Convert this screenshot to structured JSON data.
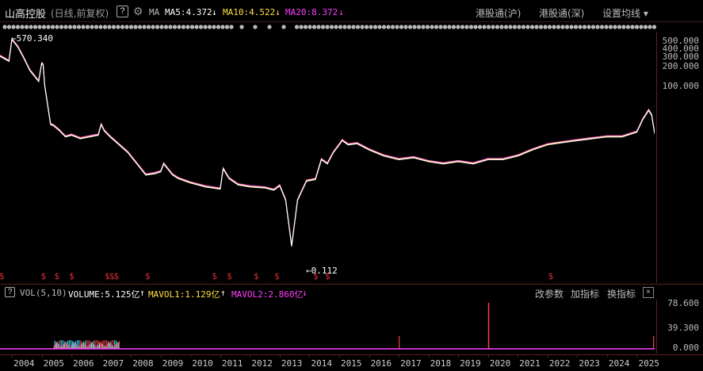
{
  "header": {
    "stock_name": "山高控股",
    "period": "(日线,前复权)",
    "help": "?",
    "ma_label": "MA",
    "ma5": "MA5:4.372",
    "ma5_arrow": "↓",
    "ma10": "MA10:4.522",
    "ma10_arrow": "↓",
    "ma20": "MA20:8.372",
    "ma20_arrow": "↓",
    "tabs": [
      "港股通(沪)",
      "港股通(深)",
      "设置均线 ▾"
    ]
  },
  "price_axis": [
    "500.000",
    "400.000",
    "300.000",
    "200.000",
    "100.000"
  ],
  "annotations": {
    "high": "570.340",
    "low": "0.112"
  },
  "dividend_marker": "$",
  "volume_panel": {
    "help": "?",
    "indicator": "VOL(5,10)",
    "volume": "VOLUME:5.125亿",
    "mavol1": "MAVOL1:1.129亿",
    "mavol1_arrow": "↑",
    "mavol2": "MAVOL2:2.860亿",
    "mavol2_arrow": "↓",
    "buttons": [
      "改参数",
      "加指标",
      "换指标"
    ],
    "close": "×",
    "axis": [
      "78.600",
      "39.300",
      "0.000"
    ]
  },
  "x_axis": [
    "2004",
    "2005",
    "2006",
    "2007",
    "2008",
    "2009",
    "2010",
    "2011",
    "2012",
    "2013",
    "2014",
    "2015",
    "2016",
    "2017",
    "2018",
    "2019",
    "2020",
    "2021",
    "2022",
    "2023",
    "2024",
    "2025"
  ],
  "colors": {
    "up": "#ff4040",
    "down": "#40e0ff",
    "ma5": "#ffffff",
    "ma10": "#ffe040",
    "ma20": "#ff40ff",
    "grid": "#5a2020"
  },
  "chart_data": {
    "type": "line",
    "title": "",
    "y_scale": "log",
    "x_range": [
      2003.6,
      2025.6
    ],
    "series": [
      {
        "name": "",
        "x": [
          2003.6,
          2003.9,
          2004.0,
          2004.2,
          2004.4,
          2004.6,
          2004.9,
          2005.0,
          2005.05,
          2005.1,
          2005.3,
          2005.4,
          2005.6,
          2005.8,
          2006.0,
          2006.3,
          2006.6,
          2006.9,
          2007.0,
          2007.1,
          2007.3,
          2007.6,
          2007.9,
          2008.2,
          2008.5,
          2008.8,
          2009.0,
          2009.1,
          2009.4,
          2009.6,
          2010.0,
          2010.5,
          2011.0,
          2011.1,
          2011.3,
          2011.6,
          2012.0,
          2012.5,
          2012.8,
          2013.0,
          2013.2,
          2013.4,
          2013.6,
          2013.9,
          2014.2,
          2014.4,
          2014.6,
          2014.8,
          2015.0,
          2015.1,
          2015.3,
          2015.6,
          2016.0,
          2016.5,
          2017.0,
          2017.5,
          2018.0,
          2018.5,
          2019.0,
          2019.5,
          2020.0,
          2020.5,
          2021.0,
          2021.5,
          2022.0,
          2022.5,
          2023.0,
          2023.5,
          2024.0,
          2024.5,
          2025.0,
          2025.2,
          2025.4,
          2025.5,
          2025.6
        ],
        "y": [
          300,
          250,
          550,
          420,
          280,
          180,
          120,
          230,
          220,
          105,
          25,
          24,
          20,
          16,
          17,
          15,
          16,
          17,
          25,
          20,
          16,
          12,
          9,
          6,
          4,
          4.2,
          4.5,
          6,
          4,
          3.5,
          3,
          2.6,
          2.4,
          5,
          3.5,
          2.8,
          2.6,
          2.5,
          2.3,
          2.7,
          1.6,
          0.3,
          1.6,
          3.2,
          3.4,
          7,
          6,
          9,
          12,
          14,
          12,
          12.5,
          10,
          8,
          7,
          7.5,
          6.5,
          6,
          6.5,
          6,
          7,
          7,
          8,
          10,
          12,
          13,
          14,
          15,
          16,
          16,
          19,
          30,
          42,
          35,
          18
        ]
      },
      {
        "name": "",
        "x": [
          2003.6,
          2025.6
        ],
        "y": [
          4.372,
          4.372
        ]
      },
      {
        "name": "",
        "x": [
          2003.6,
          2025.6
        ],
        "y": [
          4.522,
          4.522
        ]
      },
      {
        "name": "",
        "x": [
          2003.6,
          2025.6
        ],
        "y": [
          8.372,
          8.372
        ]
      }
    ],
    "ylim": [
      0.112,
      570.34
    ],
    "volume": {
      "ylim": [
        0,
        78.6
      ],
      "peak_year": 2020.0,
      "peak_value": 78.6
    }
  }
}
